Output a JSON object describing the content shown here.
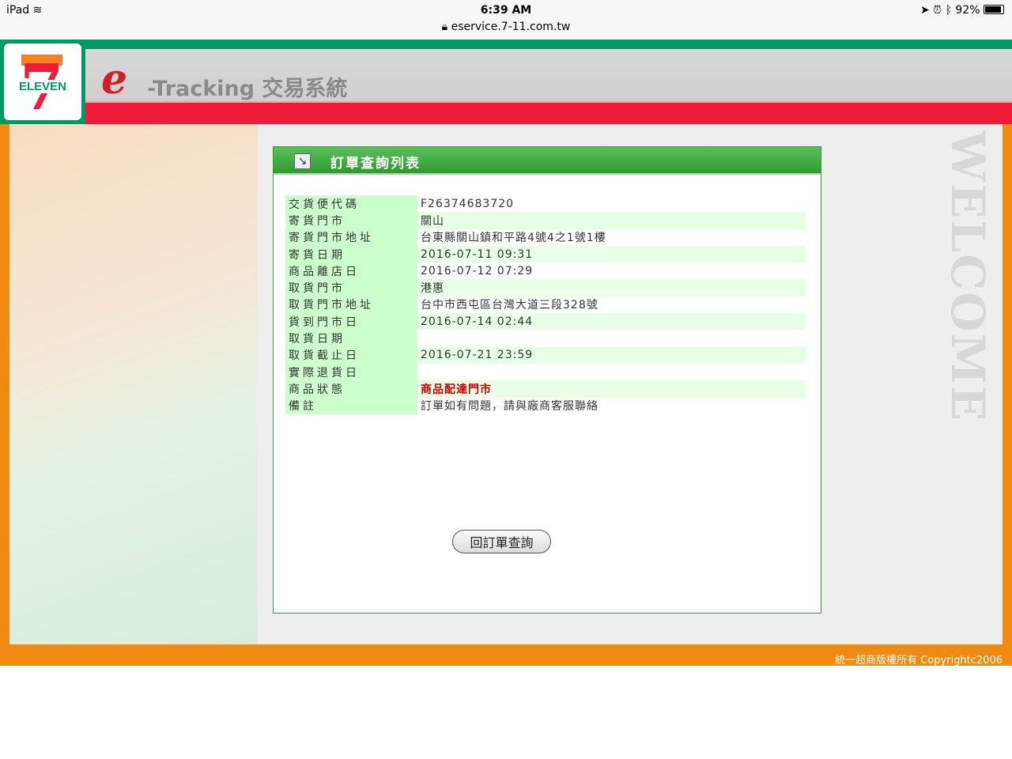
{
  "status_bar": {
    "device": "iPad",
    "time": "6:39 AM",
    "url": "eservice.7-11.com.tw",
    "battery": "92%"
  },
  "header": {
    "logo_text": "ELEVEN",
    "e_letter": "e",
    "title": "-Tracking 交易系統"
  },
  "side_text": "WELCOME",
  "panel": {
    "title": "訂單查詢列表",
    "rows": [
      {
        "label": "交貨便代碼",
        "value": "F26374683720"
      },
      {
        "label": "寄貨門市",
        "value": "關山"
      },
      {
        "label": "寄貨門市地址",
        "value": "台東縣關山鎮和平路4號4之1號1樓"
      },
      {
        "label": "寄貨日期",
        "value": "2016-07-11 09:31"
      },
      {
        "label": "商品離店日",
        "value": "2016-07-12 07:29"
      },
      {
        "label": "取貨門市",
        "value": "港惠"
      },
      {
        "label": "取貨門市地址",
        "value": "台中市西屯區台灣大道三段328號"
      },
      {
        "label": "貨到門市日",
        "value": "2016-07-14 02:44"
      },
      {
        "label": "取貨日期",
        "value": ""
      },
      {
        "label": "取貨截止日",
        "value": "2016-07-21 23:59"
      },
      {
        "label": "實際退貨日",
        "value": ""
      },
      {
        "label": "商品狀態",
        "value": "商品配達門市"
      },
      {
        "label": "備註",
        "value": "訂單如有問題，請與廠商客服聯絡"
      }
    ],
    "back_button": "回訂單查詢"
  },
  "footer": "統一超商版權所有 Copyrightc2006"
}
